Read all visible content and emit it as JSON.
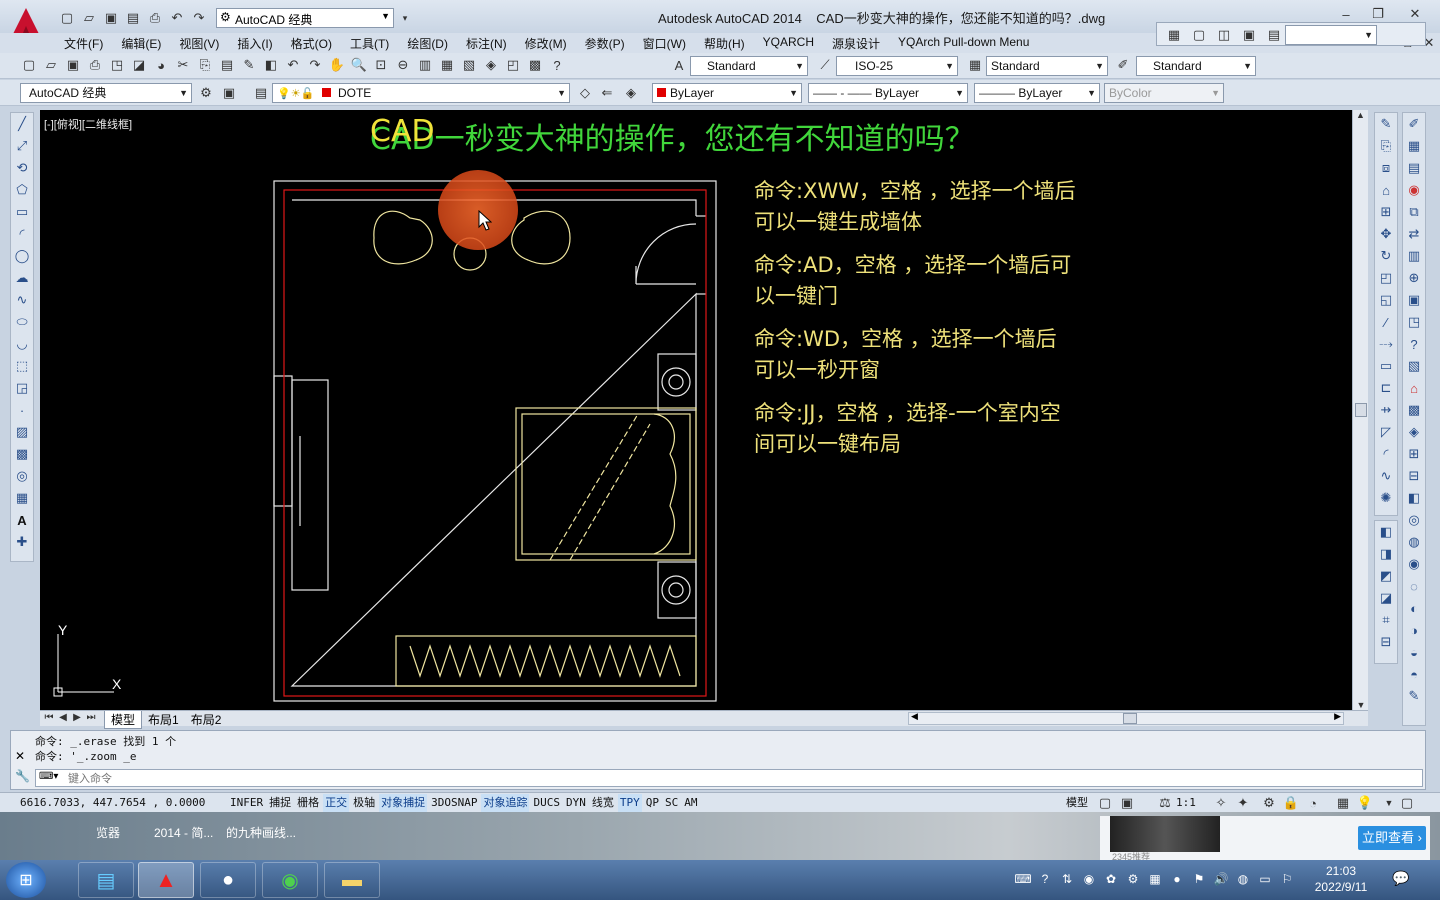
{
  "title": {
    "app": "Autodesk AutoCAD 2014",
    "doc": "CAD一秒变大神的操作，您还能不知道的吗？.dwg"
  },
  "quick_access": {
    "workspace": "AutoCAD 经典"
  },
  "menu": [
    "文件(F)",
    "编辑(E)",
    "视图(V)",
    "插入(I)",
    "格式(O)",
    "工具(T)",
    "绘图(D)",
    "标注(N)",
    "修改(M)",
    "参数(P)",
    "窗口(W)",
    "帮助(H)",
    "YQARCH",
    "源泉设计",
    "YQArch Pull-down Menu"
  ],
  "styles": {
    "text_style": "Standard",
    "dim_style": "ISO-25",
    "table_style": "Standard",
    "mleader_style": "Standard"
  },
  "layers": {
    "workspace": "AutoCAD 经典",
    "layer": "DOTE",
    "color": "ByLayer",
    "linetype": "ByLayer",
    "lineweight": "ByLayer",
    "plotstyle": "ByColor"
  },
  "viewport_label": "[-][俯视][二维线框]",
  "canvas": {
    "heading": "CAD一秒变大神的操作，您还有不知道的吗？",
    "tips": [
      {
        "line1": "命令:XWW，空格 ，选择一个墙后",
        "line2": "可以一键生成墙体"
      },
      {
        "line1": "命令:AD，空格 ，选择一个墙后可",
        "line2": "以一键门"
      },
      {
        "line1": "命令:WD，空格 ，选择一个墙后",
        "line2": "可以一秒开窗"
      },
      {
        "line1": "命令:JJ，空格 ，选择-一个室内空",
        "line2": "间可以一键布局"
      }
    ],
    "ucs_y": "Y",
    "ucs_x": "X"
  },
  "layout_tabs": [
    "模型",
    "布局1",
    "布局2"
  ],
  "command": {
    "history1": "命令: _.erase 找到 1 个",
    "history2": "命令: '_.zoom _e",
    "placeholder": "键入命令"
  },
  "status": {
    "coords": "6616.7033, 447.7654 , 0.0000",
    "toggles": [
      "INFER",
      "捕捉",
      "栅格",
      "正交",
      "极轴",
      "对象捕捉",
      "3DOSNAP",
      "对象追踪",
      "DUCS",
      "DYN",
      "线宽",
      "TPY",
      "QP",
      "SC",
      "AM"
    ],
    "model": "模型",
    "scale": "1:1"
  },
  "desktop": {
    "label1": "览器",
    "label2": "2014 - 简...",
    "label3": "的九种画线...",
    "ad_button": "立即查看 ›",
    "ad_tag": "2345推荐"
  },
  "taskbar": {
    "time": "21:03",
    "date": "2022/9/11"
  }
}
